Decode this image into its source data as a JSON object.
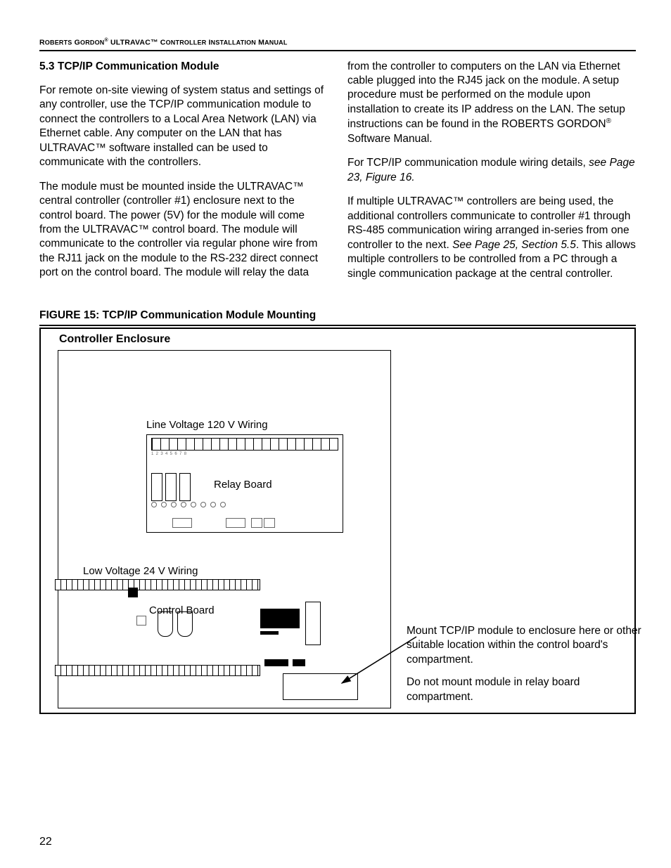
{
  "header": {
    "line": "ROBERTS GORDON® ULTRAVAC™ CONTROLLER INSTALLATION MANUAL"
  },
  "section": {
    "number_title": "5.3 TCP/IP Communication Module",
    "left_paras": [
      "For remote on-site viewing of system status and settings of any controller, use the TCP/IP communication module to connect the controllers to a Local Area Network (LAN) via Ethernet cable. Any computer on the LAN that has ULTRAVAC™ software installed can be used to communicate with the controllers.",
      "The module must be mounted inside the ULTRAVAC™ central controller (controller #1) enclosure next to the control board.   The power (5V) for the module will come from the ULTRAVAC™ control board. The module will communicate to the controller via regular phone wire from the RJ11 jack on the module to the RS-232 direct connect port on the control board. The module will relay the data"
    ],
    "right_paras": [
      {
        "text_a": "from the controller to computers on the LAN via Ethernet cable plugged into the RJ45 jack on the module. A setup procedure must be performed on the module upon installation to create its IP address on the LAN. The setup instructions can be found in the ROBERTS GORDON",
        "text_b": " Software Manual."
      },
      {
        "text_a": "For TCP/IP communication module wiring details, ",
        "ital": "see Page 23, Figure 16."
      },
      {
        "text_a": "If multiple ULTRAVAC™ controllers are being used, the additional controllers communicate to controller #1 through RS-485 communication wiring arranged in-series from one controller to the next. ",
        "ital": "See Page 25, Section 5.5",
        "text_b": ". This allows multiple controllers to be controlled from a PC through a single communication package at the central controller."
      }
    ]
  },
  "figure": {
    "caption": "FIGURE 15: TCP/IP Communication Module Mounting",
    "enclosure_title": "Controller Enclosure",
    "labels": {
      "line_voltage": "Line Voltage 120 V Wiring",
      "relay_board": "Relay Board",
      "low_voltage": "Low Voltage 24 V Wiring",
      "control_board": "Control Board"
    },
    "mount_text_1": "Mount TCP/IP module to enclosure here or other suitable location within the control board's compartment.",
    "mount_text_2": "Do not mount module in relay board compartment."
  },
  "page_number": "22"
}
